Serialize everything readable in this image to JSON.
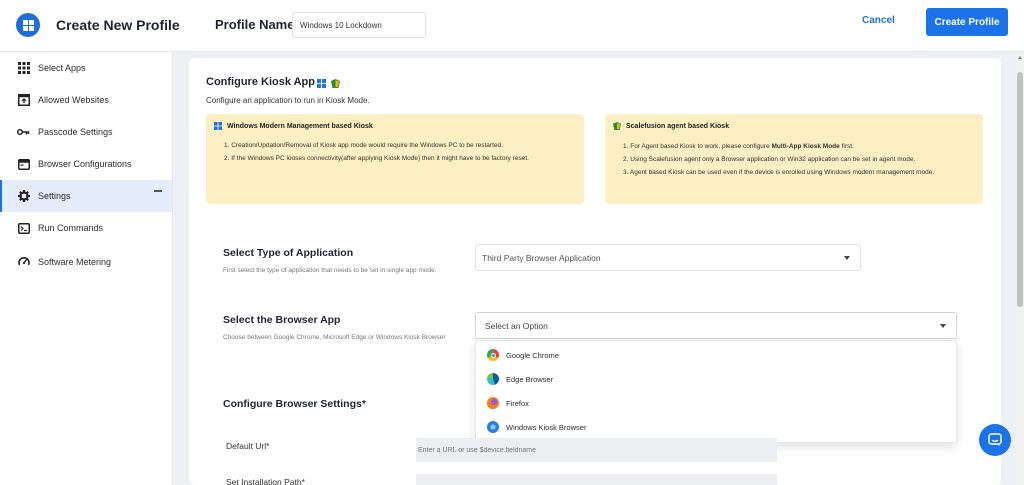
{
  "header": {
    "title": "Create New Profile",
    "profile_name_label": "Profile Name",
    "profile_name_value": "Windows 10 Lockdown",
    "cancel_label": "Cancel",
    "create_label": "Create Profile"
  },
  "sidebar": {
    "items": [
      {
        "label": "Select Apps",
        "icon": "grid-icon"
      },
      {
        "label": "Allowed Websites",
        "icon": "browser-window-icon"
      },
      {
        "label": "Passcode Settings",
        "icon": "key-icon"
      },
      {
        "label": "Browser Configurations",
        "icon": "browser-icon"
      },
      {
        "label": "Settings",
        "icon": "gear-icon",
        "active": true
      },
      {
        "label": "Run Commands",
        "icon": "terminal-icon"
      },
      {
        "label": "Software Metering",
        "icon": "speedometer-icon"
      }
    ]
  },
  "main": {
    "title": "Configure Kiosk App",
    "subtitle": "Configure an application to run in Kiosk Mode.",
    "info_left": {
      "heading": "Windows Modern Management based Kiosk",
      "items": [
        "Creation/Updation/Removal of Kiosk app mode would require the Windows PC to be restarted.",
        "If the Windows PC looses connectivity(after applying Kiosk Mode) then it might have to be factory reset."
      ]
    },
    "info_right": {
      "heading": "Scalefusion agent based Kiosk",
      "item1_pre": "For Agent based Kiosk to work, please configure ",
      "item1_bold": "Multi-App Kiosk Mode",
      "item1_post": " first.",
      "item2": "Using Scalefusion agent only a Browser application or Win32 application can be set in agent mode.",
      "item3": "Agent based Kiosk can be used even if the device is enrolled using Windows modern management mode."
    },
    "app_type": {
      "title": "Select Type of Application",
      "desc": "First select the type of application that needs to be set in single app mode.",
      "value": "Third Party Browser Application"
    },
    "browser_app": {
      "title": "Select the Browser App",
      "desc": "Choose between Google Chrome, Microsoft Edge or Windows Kiosk Browser",
      "placeholder": "Select an Option",
      "options": [
        {
          "label": "Google Chrome",
          "color": "#e94235"
        },
        {
          "label": "Edge Browser",
          "color": "#1f8fd6"
        },
        {
          "label": "Firefox",
          "color": "#ff7a1a"
        },
        {
          "label": "Windows Kiosk Browser",
          "color": "#2b7de0"
        }
      ]
    },
    "browser_settings": {
      "title": "Configure Browser Settings*",
      "default_url_label": "Default Url*",
      "default_url_placeholder": "Enter a URL or use $device.fieldname",
      "install_path_label": "Set Installation Path*"
    }
  },
  "colors": {
    "accent": "#1a73e8",
    "info_bg": "#fcefc3",
    "active_bg": "#e5ecfa"
  }
}
